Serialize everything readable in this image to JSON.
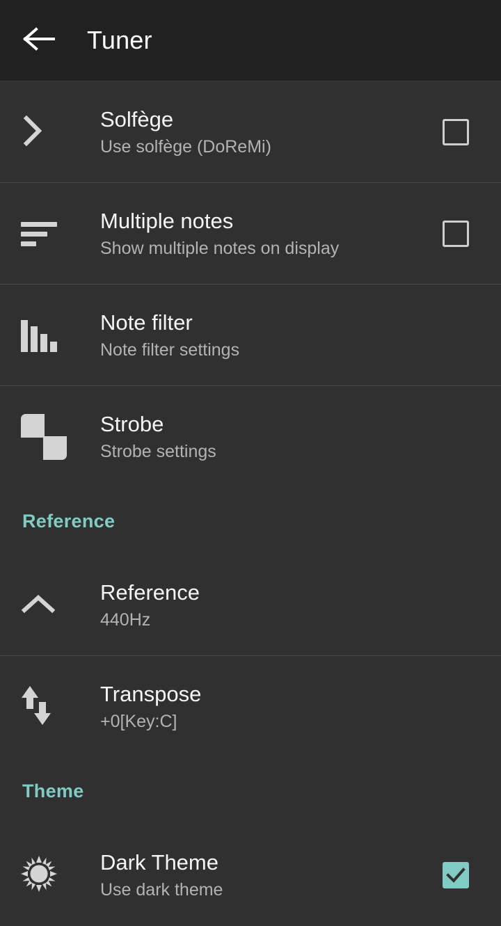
{
  "toolbar": {
    "back_icon": "arrow-left-icon",
    "title": "Tuner"
  },
  "colors": {
    "background": "#303030",
    "toolbar_background": "#212121",
    "accent": "#80cbc4",
    "title_text": "#f5f5f5",
    "summary_text": "#b3b3b3",
    "icon": "#d4d4d4"
  },
  "settings": [
    {
      "key": "solfege",
      "icon": "chevron-right-icon",
      "title": "Solfège",
      "summary": "Use solfège (DoReMi)",
      "widget": "checkbox",
      "checked": false
    },
    {
      "key": "multiple_notes",
      "icon": "list-bars-icon",
      "title": "Multiple notes",
      "summary": "Show multiple notes on display",
      "widget": "checkbox",
      "checked": false
    },
    {
      "key": "note_filter",
      "icon": "bar-chart-icon",
      "title": "Note filter",
      "summary": "Note filter settings",
      "widget": "none",
      "checked": false
    },
    {
      "key": "strobe",
      "icon": "strobe-squares-icon",
      "title": "Strobe",
      "summary": "Strobe settings",
      "widget": "none",
      "checked": false
    }
  ],
  "sections": [
    {
      "key": "reference",
      "header": "Reference",
      "items": [
        {
          "key": "reference_pitch",
          "icon": "chevron-up-icon",
          "title": "Reference",
          "summary": "440Hz",
          "widget": "none",
          "checked": false
        },
        {
          "key": "transpose",
          "icon": "up-down-arrows-icon",
          "title": "Transpose",
          "summary": "+0[Key:C]",
          "widget": "none",
          "checked": false
        }
      ]
    },
    {
      "key": "theme",
      "header": "Theme",
      "items": [
        {
          "key": "dark_theme",
          "icon": "sun-icon",
          "title": "Dark Theme",
          "summary": "Use dark theme",
          "widget": "checkbox",
          "checked": true
        }
      ]
    }
  ]
}
